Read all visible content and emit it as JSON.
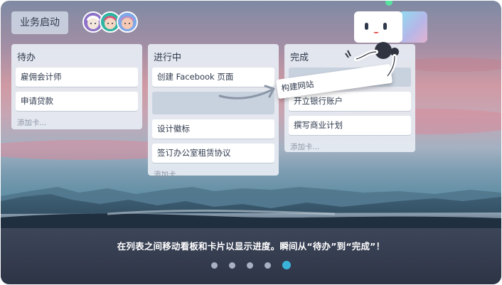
{
  "board": {
    "title": "业务启动"
  },
  "avatars": [
    "avatar-1",
    "avatar-2",
    "avatar-3"
  ],
  "lists": [
    {
      "title": "待办",
      "cards": [
        "雇佣会计师",
        "申请贷款"
      ],
      "add_card": "添加卡..."
    },
    {
      "title": "进行中",
      "cards": [
        "创建 Facebook 页面",
        "设计徽标",
        "签订办公室租赁协议"
      ],
      "add_card": "添加卡..."
    },
    {
      "title": "完成",
      "cards": [
        "开立银行账户",
        "撰写商业计划"
      ],
      "add_card": "添加卡..."
    }
  ],
  "dragging_card": "构建网站",
  "caption": "在列表之间移动看板和卡片以显示进度。瞬间从“待办”到“完成”！",
  "pagination": {
    "total": 5,
    "active": 5
  },
  "colors": {
    "accent": "#3bb3d9",
    "list_bg": "#e6ebf2",
    "text": "#2f3a4d"
  }
}
